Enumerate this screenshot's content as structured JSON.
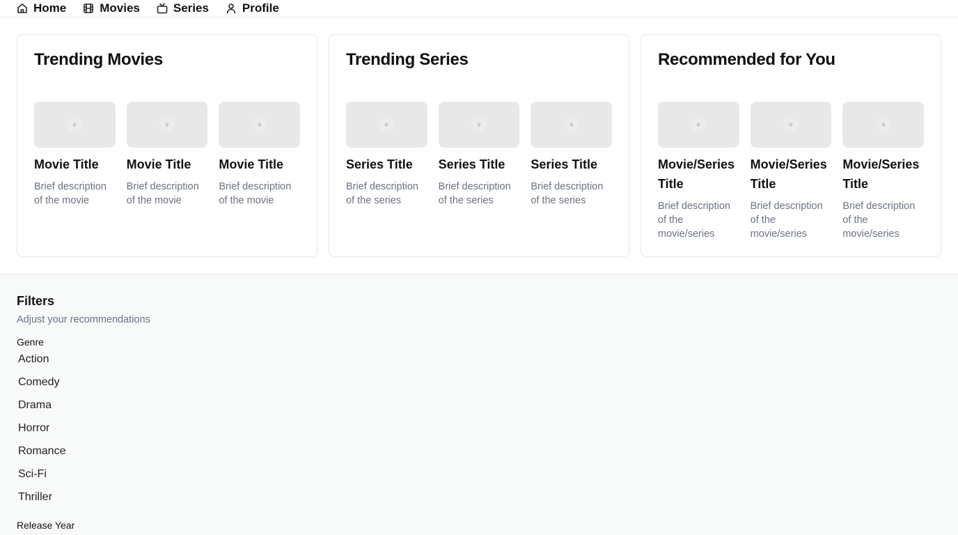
{
  "nav": {
    "items": [
      {
        "label": "Home",
        "icon": "home-icon"
      },
      {
        "label": "Movies",
        "icon": "film-icon"
      },
      {
        "label": "Series",
        "icon": "tv-icon"
      },
      {
        "label": "Profile",
        "icon": "user-icon"
      }
    ]
  },
  "sections": [
    {
      "title": "Trending Movies",
      "items": [
        {
          "title": "Movie Title",
          "desc": "Brief description of the movie"
        },
        {
          "title": "Movie Title",
          "desc": "Brief description of the movie"
        },
        {
          "title": "Movie Title",
          "desc": "Brief description of the movie"
        }
      ]
    },
    {
      "title": "Trending Series",
      "items": [
        {
          "title": "Series Title",
          "desc": "Brief description of the series"
        },
        {
          "title": "Series Title",
          "desc": "Brief description of the series"
        },
        {
          "title": "Series Title",
          "desc": "Brief description of the series"
        }
      ]
    },
    {
      "title": "Recommended for You",
      "items": [
        {
          "title": "Movie/Series Title",
          "desc": "Brief description of the movie/series"
        },
        {
          "title": "Movie/Series Title",
          "desc": "Brief description of the movie/series"
        },
        {
          "title": "Movie/Series Title",
          "desc": "Brief description of the movie/series"
        }
      ]
    }
  ],
  "filters": {
    "title": "Filters",
    "subtitle": "Adjust your recommendations",
    "genre_label": "Genre",
    "genres": [
      "Action",
      "Comedy",
      "Drama",
      "Horror",
      "Romance",
      "Sci-Fi",
      "Thriller"
    ],
    "release_year_label": "Release Year"
  }
}
